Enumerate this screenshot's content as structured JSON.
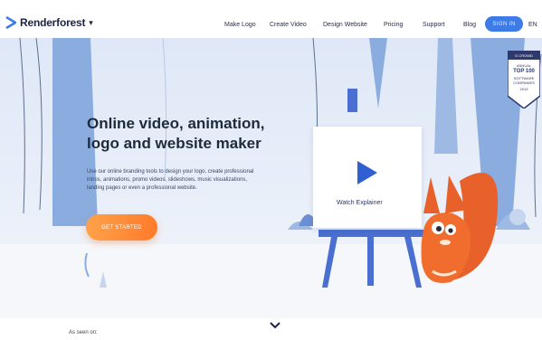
{
  "header": {
    "brand": "Renderforest",
    "nav": [
      {
        "label": "Make Logo"
      },
      {
        "label": "Create Video"
      },
      {
        "label": "Design Website"
      },
      {
        "label": "Pricing"
      },
      {
        "label": "Support"
      },
      {
        "label": "Blog"
      }
    ],
    "signin_label": "SIGN IN",
    "language": "EN"
  },
  "hero": {
    "headline_line1": "Online video, animation,",
    "headline_line2": "logo and website maker",
    "description_lines": [
      "Use our online branding tools to design your logo, create professional",
      "intros, animations, promo videos, slideshows, music visualizations,",
      "landing pages or even a professional website."
    ],
    "cta_label": "GET STARTED",
    "watch_label": "Watch Explainer"
  },
  "badge": {
    "brand": "G CROWD",
    "line1": "ANNUAL",
    "line2": "TOP 100",
    "line3": "SOFTWARE",
    "line4": "COMPANIES",
    "year": "2019"
  },
  "footer": {
    "seen_on": "As seen on:"
  },
  "colors": {
    "accent_blue": "#3d7be6",
    "cta_orange": "#ff8a33",
    "navy": "#1d2347"
  }
}
